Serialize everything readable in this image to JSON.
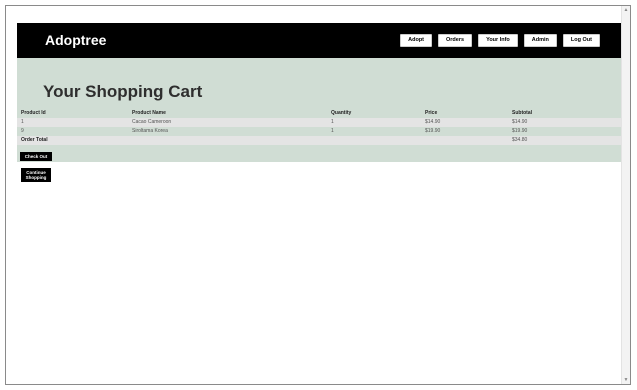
{
  "navbar": {
    "brand": "Adoptree",
    "links": [
      "Adopt",
      "Orders",
      "Your Info",
      "Admin",
      "Log Out"
    ]
  },
  "cart": {
    "title": "Your Shopping Cart",
    "columns": [
      "Product Id",
      "Product Name",
      "Quantity",
      "Price",
      "Subtotal"
    ],
    "rows": [
      [
        "1",
        "Cacao Cameroon",
        "1",
        "$14.90",
        "$14.90"
      ],
      [
        "9",
        "Siroltama Korea",
        "1",
        "$19.90",
        "$19.90"
      ]
    ],
    "total_label": "Order Total",
    "total_value": "$34.80"
  },
  "buttons": {
    "checkout": "Check Out",
    "continue_line1": "Continue",
    "continue_line2": "Shopping"
  },
  "icons": {
    "scroll_up": "scroll-up-arrow",
    "scroll_down": "scroll-down-arrow"
  },
  "colors": {
    "navbar": "#000000",
    "band": "#d0ddd4",
    "row_light": "#e4e4e4"
  }
}
